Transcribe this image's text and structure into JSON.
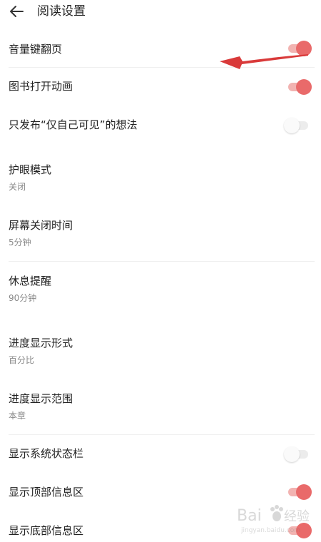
{
  "header": {
    "title": "阅读设置"
  },
  "settings": {
    "volume_key_turn": {
      "label": "音量键翻页",
      "enabled": true
    },
    "book_open_animation": {
      "label": "图书打开动画",
      "enabled": true
    },
    "private_thoughts": {
      "label": "只发布“仅自己可见”的想法",
      "enabled": false
    },
    "eye_care_mode": {
      "label": "护眼模式",
      "value": "关闭"
    },
    "screen_off_time": {
      "label": "屏幕关闭时间",
      "value": "5分钟"
    },
    "rest_reminder": {
      "label": "休息提醒",
      "value": "90分钟"
    },
    "progress_format": {
      "label": "进度显示形式",
      "value": "百分比"
    },
    "progress_range": {
      "label": "进度显示范围",
      "value": "本章"
    },
    "show_status_bar": {
      "label": "显示系统状态栏",
      "enabled": false
    },
    "show_top_info": {
      "label": "显示顶部信息区",
      "enabled": true
    },
    "show_bottom_info": {
      "label": "显示底部信息区",
      "enabled": true
    }
  },
  "colors": {
    "accent": "#e96a6a",
    "accent_track": "#f2b3b1",
    "annotation_arrow": "#d93a3a"
  },
  "watermark": {
    "text": "Bai du 经验",
    "subtext": "jingyan.baidu.com"
  }
}
